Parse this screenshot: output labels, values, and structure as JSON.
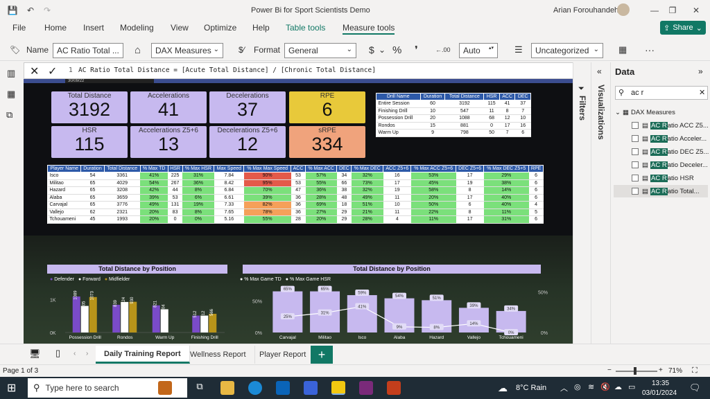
{
  "window": {
    "title": "Power Bi for Sport Scientists Demo",
    "user": "Arian Forouhandeh"
  },
  "menu": [
    "File",
    "Home",
    "Insert",
    "Modeling",
    "View",
    "Optimize",
    "Help",
    "Table tools",
    "Measure tools"
  ],
  "share_label": "Share",
  "ribbon": {
    "name_label": "Name",
    "name_value": "AC Ratio Total ...",
    "home_table": "DAX Measures",
    "format_label": "Format",
    "format_value": "General",
    "currency": "$",
    "percent": "%",
    "comma": "❜",
    "decimals": "Auto",
    "category": "Uncategorized",
    "more": "···"
  },
  "formula": {
    "line": "1",
    "text": "AC Ratio Total Distance = [Acute Total Distance] / [Chronic Total Distance]"
  },
  "date_chip": "30/09/22",
  "kpis": [
    {
      "label": "Total Distance",
      "value": "3192"
    },
    {
      "label": "Accelerations",
      "value": "41"
    },
    {
      "label": "Decelerations",
      "value": "37"
    },
    {
      "label": "RPE",
      "value": "6"
    },
    {
      "label": "HSR",
      "value": "115"
    },
    {
      "label": "Accelerations Z5+6",
      "value": "13"
    },
    {
      "label": "Decelerations Z5+6",
      "value": "12"
    },
    {
      "label": "sRPE",
      "value": "334"
    }
  ],
  "drill_table": {
    "headers": [
      "Drill Name",
      "Duration",
      "Total Distance",
      "HSR",
      "ACC",
      "DEC"
    ],
    "rows": [
      [
        "Entire Session",
        "60",
        "3192",
        "115",
        "41",
        "37"
      ],
      [
        "Finishing Drill",
        "10",
        "547",
        "11",
        "8",
        "7"
      ],
      [
        "Possession Drill",
        "20",
        "1088",
        "68",
        "12",
        "10"
      ],
      [
        "Rondos",
        "15",
        "881",
        "0",
        "17",
        "16"
      ],
      [
        "Warm Up",
        "9",
        "798",
        "50",
        "7",
        "6"
      ]
    ]
  },
  "player_table": {
    "headers": [
      "Player Name",
      "Duration",
      "Total Distance",
      "% Max TD",
      "HSR",
      "% Max HSR",
      "Max Speed",
      "% Max Max Speed",
      "ACC",
      "% Max ACC",
      "DEC",
      "% Max DEC",
      "ACC Z5+6",
      "% Max ACC Z5+6",
      "DEC Z5+6",
      "% Max DEC Z5+5",
      "RPE"
    ],
    "rows": [
      [
        "Isco",
        "54",
        "3361",
        "41%",
        "225",
        "31%",
        "7.84",
        "90%",
        "53",
        "57%",
        "34",
        "32%",
        "16",
        "53%",
        "17",
        "29%",
        "6"
      ],
      [
        "Militao",
        "65",
        "4029",
        "54%",
        "267",
        "36%",
        "8.42",
        "95%",
        "53",
        "55%",
        "66",
        "73%",
        "17",
        "45%",
        "19",
        "38%",
        "6"
      ],
      [
        "Hazard",
        "65",
        "3208",
        "42%",
        "44",
        "8%",
        "6.84",
        "70%",
        "47",
        "36%",
        "38",
        "32%",
        "19",
        "58%",
        "8",
        "14%",
        "6"
      ],
      [
        "Alaba",
        "65",
        "3659",
        "39%",
        "53",
        "6%",
        "6.61",
        "39%",
        "36",
        "28%",
        "48",
        "49%",
        "11",
        "20%",
        "17",
        "40%",
        "6"
      ],
      [
        "Carvajal",
        "65",
        "3776",
        "49%",
        "131",
        "19%",
        "7.33",
        "82%",
        "36",
        "69%",
        "18",
        "51%",
        "10",
        "50%",
        "6",
        "40%",
        "4"
      ],
      [
        "Vallejo",
        "62",
        "2321",
        "20%",
        "83",
        "8%",
        "7.65",
        "78%",
        "36",
        "27%",
        "29",
        "21%",
        "11",
        "22%",
        "8",
        "11%",
        "5"
      ],
      [
        "Tchouameni",
        "45",
        "1993",
        "20%",
        "0",
        "0%",
        "5.16",
        "55%",
        "28",
        "20%",
        "29",
        "28%",
        "4",
        "11%",
        "17",
        "31%",
        "6"
      ]
    ],
    "styles": [
      [
        "",
        "",
        "",
        "g",
        "",
        "g",
        "",
        "r",
        "",
        "g",
        "",
        "g",
        "",
        "g",
        "",
        "g",
        ""
      ],
      [
        "",
        "",
        "",
        "g",
        "",
        "g",
        "",
        "r",
        "",
        "g",
        "",
        "g",
        "",
        "g",
        "",
        "g",
        ""
      ],
      [
        "",
        "",
        "",
        "g",
        "",
        "g",
        "",
        "g",
        "",
        "g",
        "",
        "g",
        "",
        "g",
        "",
        "g",
        ""
      ],
      [
        "",
        "",
        "",
        "g",
        "",
        "g",
        "",
        "g",
        "",
        "g",
        "",
        "g",
        "",
        "g",
        "",
        "g",
        ""
      ],
      [
        "",
        "",
        "",
        "g",
        "",
        "g",
        "",
        "o",
        "",
        "g",
        "",
        "g",
        "",
        "g",
        "",
        "g",
        ""
      ],
      [
        "",
        "",
        "",
        "g",
        "",
        "g",
        "",
        "o",
        "",
        "g",
        "",
        "g",
        "",
        "g",
        "",
        "g",
        ""
      ],
      [
        "",
        "",
        "",
        "g",
        "",
        "g",
        "",
        "g",
        "",
        "g",
        "",
        "g",
        "",
        "g",
        "",
        "g",
        ""
      ]
    ]
  },
  "chart1": {
    "title": "Total Distance by Position",
    "legend": [
      "Defender",
      "Forward",
      "Midfielder"
    ],
    "colors": [
      "#7a4bc8",
      "#ffffff",
      "#b8941a"
    ],
    "ytick": "1K",
    "ytick0": "0K",
    "chart_data": {
      "type": "bar",
      "categories": [
        "Possession Drill",
        "Rondos",
        "Warm Up",
        "Finishing Drill"
      ],
      "series": [
        {
          "name": "Defender",
          "values": [
            1089,
            839,
            821,
            512
          ]
        },
        {
          "name": "Forward",
          "values": [
            805,
            924,
            704,
            512
          ]
        },
        {
          "name": "Midfielder",
          "values": [
            1073,
            930,
            null,
            566
          ]
        }
      ],
      "ylim": [
        0,
        1300
      ]
    }
  },
  "chart2": {
    "title": "Total Distance by Position",
    "legend": [
      "% Max Game TD",
      "% Max Game HSR"
    ],
    "yl": [
      "50%",
      "0%"
    ],
    "yr": [
      "50%",
      "0%"
    ],
    "chart_data": {
      "type": "bar",
      "categories": [
        "Carvajal",
        "Militao",
        "Isco",
        "Alaba",
        "Hazard",
        "Vallejo",
        "Tchouameni"
      ],
      "series": [
        {
          "name": "% Max Game TD",
          "values": [
            65,
            65,
            59,
            54,
            51,
            39,
            34
          ]
        },
        {
          "name": "% Max Game HSR",
          "values": [
            25,
            31,
            41,
            9,
            8,
            14,
            0
          ]
        }
      ],
      "ylim": [
        0,
        70
      ]
    }
  },
  "right_panels": {
    "filters": "Filters",
    "visualizations": "Visualizations",
    "data_title": "Data",
    "search_value": "ac r"
  },
  "data_tree": {
    "group": "DAX Measures",
    "fields": [
      {
        "hl": "AC R",
        "rest": "atio ACC Z5..."
      },
      {
        "hl": "AC R",
        "rest": "atio Acceler..."
      },
      {
        "hl": "AC R",
        "rest": "atio DEC Z5..."
      },
      {
        "hl": "AC R",
        "rest": "atio Deceler..."
      },
      {
        "hl": "AC R",
        "rest": "atio HSR"
      },
      {
        "hl": "AC R",
        "rest": "atio Total..."
      }
    ]
  },
  "tabs": [
    "Daily Training Report",
    "Wellness Report",
    "Player Report"
  ],
  "status": {
    "page": "Page 1 of 3",
    "zoom": "71%"
  },
  "taskbar": {
    "search_placeholder": "Type here to search",
    "weather": "8°C  Rain",
    "time": "13:35",
    "date": "03/01/2024"
  }
}
